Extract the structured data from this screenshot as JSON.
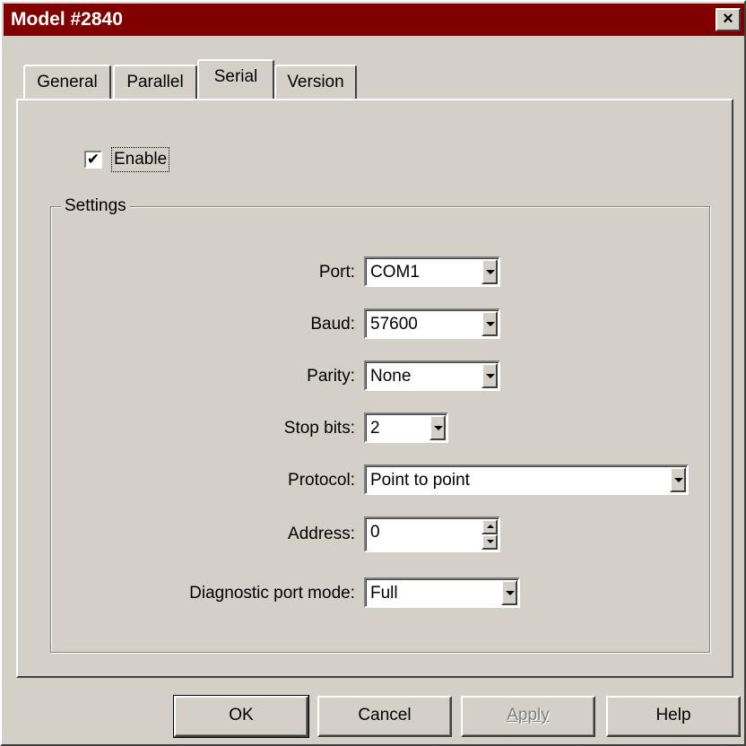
{
  "window": {
    "title": "Model #2840",
    "close_label": "×"
  },
  "tabs": [
    {
      "label": "General",
      "active": false
    },
    {
      "label": "Parallel",
      "active": false
    },
    {
      "label": "Serial",
      "active": true
    },
    {
      "label": "Version",
      "active": false
    }
  ],
  "enable": {
    "label": "Enable",
    "checked": true,
    "check_glyph": "✔"
  },
  "settings": {
    "group_label": "Settings",
    "port": {
      "label": "Port:",
      "value": "COM1"
    },
    "baud": {
      "label": "Baud:",
      "value": "57600"
    },
    "parity": {
      "label": "Parity:",
      "value": "None"
    },
    "stop_bits": {
      "label": "Stop bits:",
      "value": "2"
    },
    "protocol": {
      "label": "Protocol:",
      "value": "Point to point"
    },
    "address": {
      "label": "Address:",
      "value": "0"
    },
    "diagnostic": {
      "label": "Diagnostic port mode:",
      "value": "Full"
    }
  },
  "buttons": {
    "ok": "OK",
    "cancel": "Cancel",
    "apply": "Apply",
    "help": "Help"
  },
  "colors": {
    "titlebar": "#800000",
    "face": "#d4d0c8"
  }
}
